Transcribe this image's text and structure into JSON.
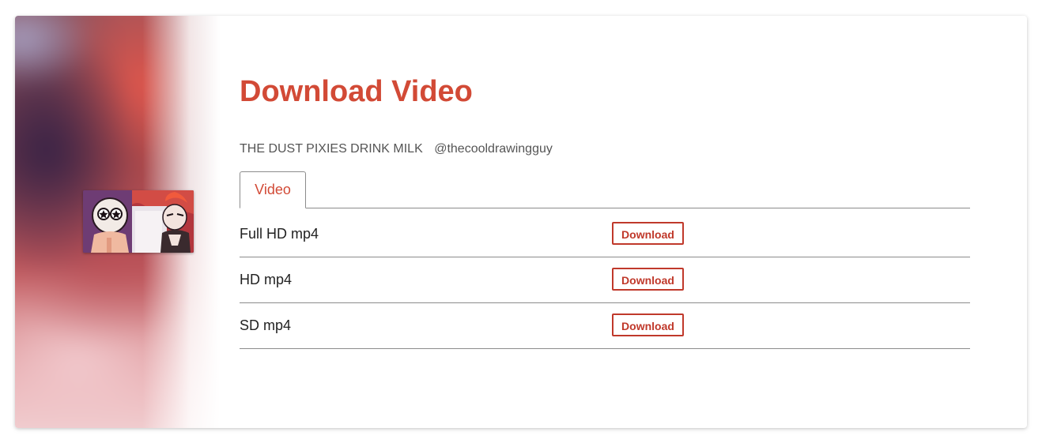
{
  "page": {
    "title": "Download Video",
    "accent_color": "#d24a36"
  },
  "video": {
    "name": "THE DUST PIXIES DRINK MILK",
    "author": "@thecooldrawingguy"
  },
  "tabs": [
    {
      "label": "Video",
      "active": true
    }
  ],
  "formats": [
    {
      "label": "Full HD mp4",
      "button_label": "Download"
    },
    {
      "label": "HD mp4",
      "button_label": "Download"
    },
    {
      "label": "SD mp4",
      "button_label": "Download"
    }
  ],
  "icons": {
    "thumbnail": "video-thumbnail-image"
  }
}
